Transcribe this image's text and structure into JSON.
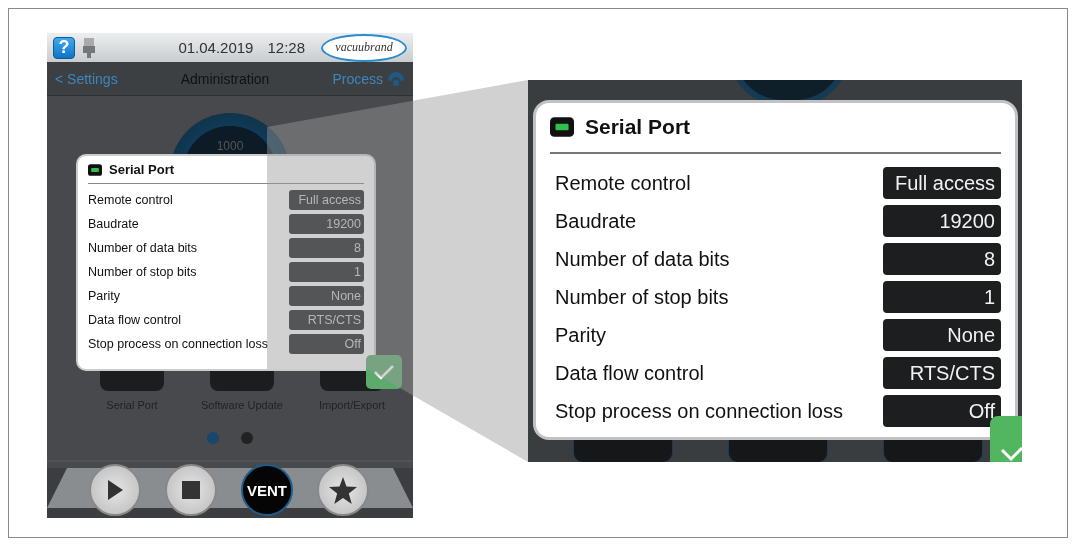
{
  "device": {
    "status_bar": {
      "help": "?",
      "date": "01.04.2019",
      "time": "12:28",
      "logo": "vacuubrand"
    },
    "nav": {
      "back": "< Settings",
      "title": "Administration",
      "process": "Process"
    },
    "gauge": {
      "reading": "1000"
    },
    "dialog": {
      "title": "Serial Port",
      "rows": [
        {
          "label": "Remote control",
          "value": "Full access"
        },
        {
          "label": "Baudrate",
          "value": "19200"
        },
        {
          "label": "Number of data bits",
          "value": "8"
        },
        {
          "label": "Number of stop bits",
          "value": "1"
        },
        {
          "label": "Parity",
          "value": "None"
        },
        {
          "label": "Data flow control",
          "value": "RTS/CTS"
        },
        {
          "label": "Stop process on connection loss",
          "value": "Off"
        }
      ]
    },
    "tiles": [
      {
        "label": "Serial Port"
      },
      {
        "label": "Software Update"
      },
      {
        "label": "Import/Export"
      }
    ],
    "page_dots": [
      {
        "selected": true
      },
      {
        "selected": false
      }
    ],
    "controls": [
      {
        "kind": "play"
      },
      {
        "kind": "stop"
      },
      {
        "kind": "text",
        "label": "VENT"
      },
      {
        "kind": "star"
      }
    ]
  },
  "zoom_inset": {
    "dialog": {
      "title": "Serial Port",
      "rows": [
        {
          "label": "Remote control",
          "value": "Full access"
        },
        {
          "label": "Baudrate",
          "value": "19200"
        },
        {
          "label": "Number of data bits",
          "value": "8"
        },
        {
          "label": "Number of stop bits",
          "value": "1"
        },
        {
          "label": "Parity",
          "value": "None"
        },
        {
          "label": "Data flow control",
          "value": "RTS/CTS"
        },
        {
          "label": "Stop process on connection loss",
          "value": "Off"
        }
      ]
    }
  }
}
